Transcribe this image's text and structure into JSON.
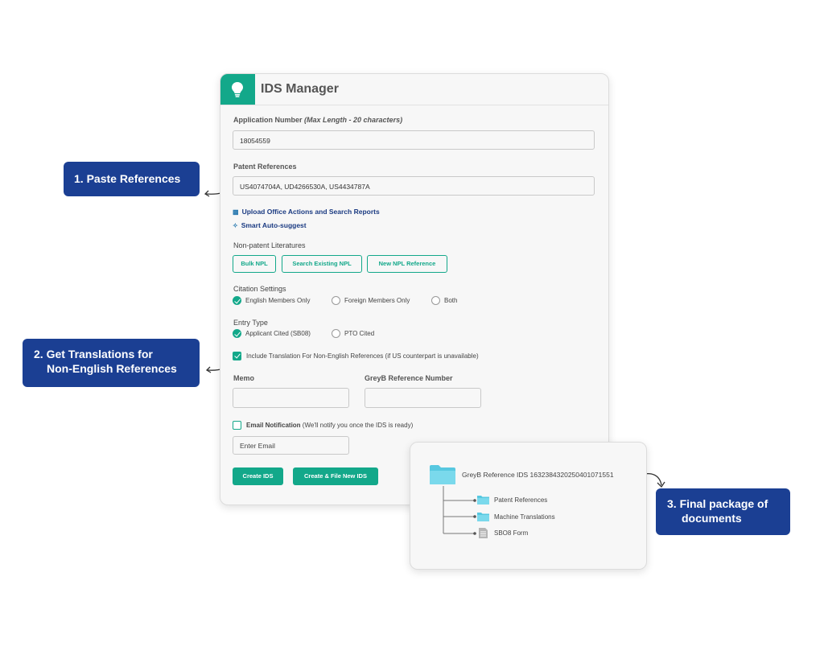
{
  "app": {
    "title": "IDS Manager",
    "logo_icon": "lightbulb-icon",
    "accent": "#13a88a",
    "callout_color": "#1b3f93"
  },
  "form": {
    "application_number": {
      "label": "Application Number",
      "hint": "(Max Length - 20 characters)",
      "value": "18054559"
    },
    "patent_references": {
      "label": "Patent References",
      "value": "US4074704A,  UD4266530A,  US4434787A"
    },
    "links": {
      "upload": "Upload Office Actions and Search Reports",
      "autosuggest": "Smart Auto-suggest"
    },
    "npl": {
      "label": "Non-patent Literatures",
      "buttons": [
        "Bulk NPL",
        "Search Existing NPL",
        "New NPL Reference"
      ]
    },
    "citation": {
      "label": "Citation Settings",
      "options": [
        "English Members Only",
        "Foreign Members Only",
        "Both"
      ],
      "selected": "English Members Only"
    },
    "entry_type": {
      "label": "Entry Type",
      "options": [
        "Applicant Cited (SB08)",
        "PTO Cited"
      ],
      "selected": "Applicant Cited (SB08)"
    },
    "translation": {
      "checked": true,
      "label": "Include Translation For Non-English References",
      "note": "(if US counterpart is unavailable)"
    },
    "memo": {
      "label": "Memo",
      "value": ""
    },
    "greyb_ref": {
      "label": "GreyB Reference Number",
      "value": ""
    },
    "email": {
      "checked": false,
      "label": "Email Notification",
      "note": "(We'll notify you once the IDS is ready)",
      "placeholder": "Enter Email"
    },
    "actions": {
      "create": "Create IDS",
      "create_file": "Create & File New IDS"
    }
  },
  "callouts": {
    "paste": "1.  Paste References",
    "translate_line1": "2. Get Translations for",
    "translate_line2": "Non-English References",
    "final_line1": "3.  Final package of",
    "final_line2": "documents"
  },
  "package": {
    "title": "GreyB Reference  IDS  16323843202504010715​51",
    "items": [
      {
        "name": "Patent References",
        "icon": "folder-icon"
      },
      {
        "name": "Machine Translations",
        "icon": "folder-icon"
      },
      {
        "name": "SBO8 Form",
        "icon": "document-icon"
      }
    ]
  }
}
